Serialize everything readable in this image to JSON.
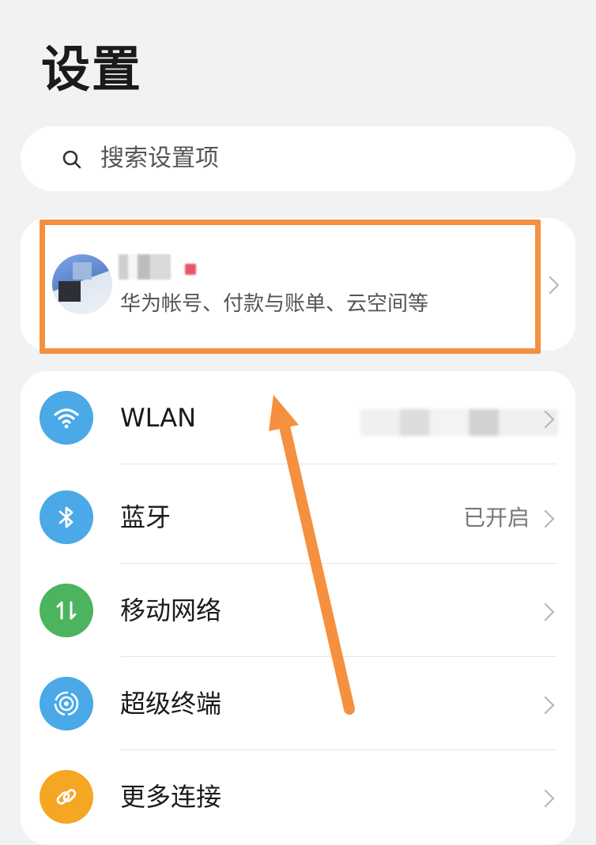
{
  "page": {
    "title": "设置"
  },
  "search": {
    "placeholder": "搜索设置项",
    "icon": "search-icon"
  },
  "account": {
    "description": "华为帐号、付款与账单、云空间等"
  },
  "settings": [
    {
      "key": "wlan",
      "label": "WLAN",
      "value": "",
      "icon": "wifi-icon",
      "color": "#4aa9e6"
    },
    {
      "key": "bluetooth",
      "label": "蓝牙",
      "value": "已开启",
      "icon": "bluetooth-icon",
      "color": "#4aa9e6"
    },
    {
      "key": "mobile-network",
      "label": "移动网络",
      "value": "",
      "icon": "mobile-data-icon",
      "color": "#4cb35e"
    },
    {
      "key": "super-device",
      "label": "超级终端",
      "value": "",
      "icon": "super-device-icon",
      "color": "#4aa9e6"
    },
    {
      "key": "more-connections",
      "label": "更多连接",
      "value": "",
      "icon": "link-icon",
      "color": "#f5a623"
    }
  ],
  "annotation": {
    "color": "#f5903f"
  }
}
